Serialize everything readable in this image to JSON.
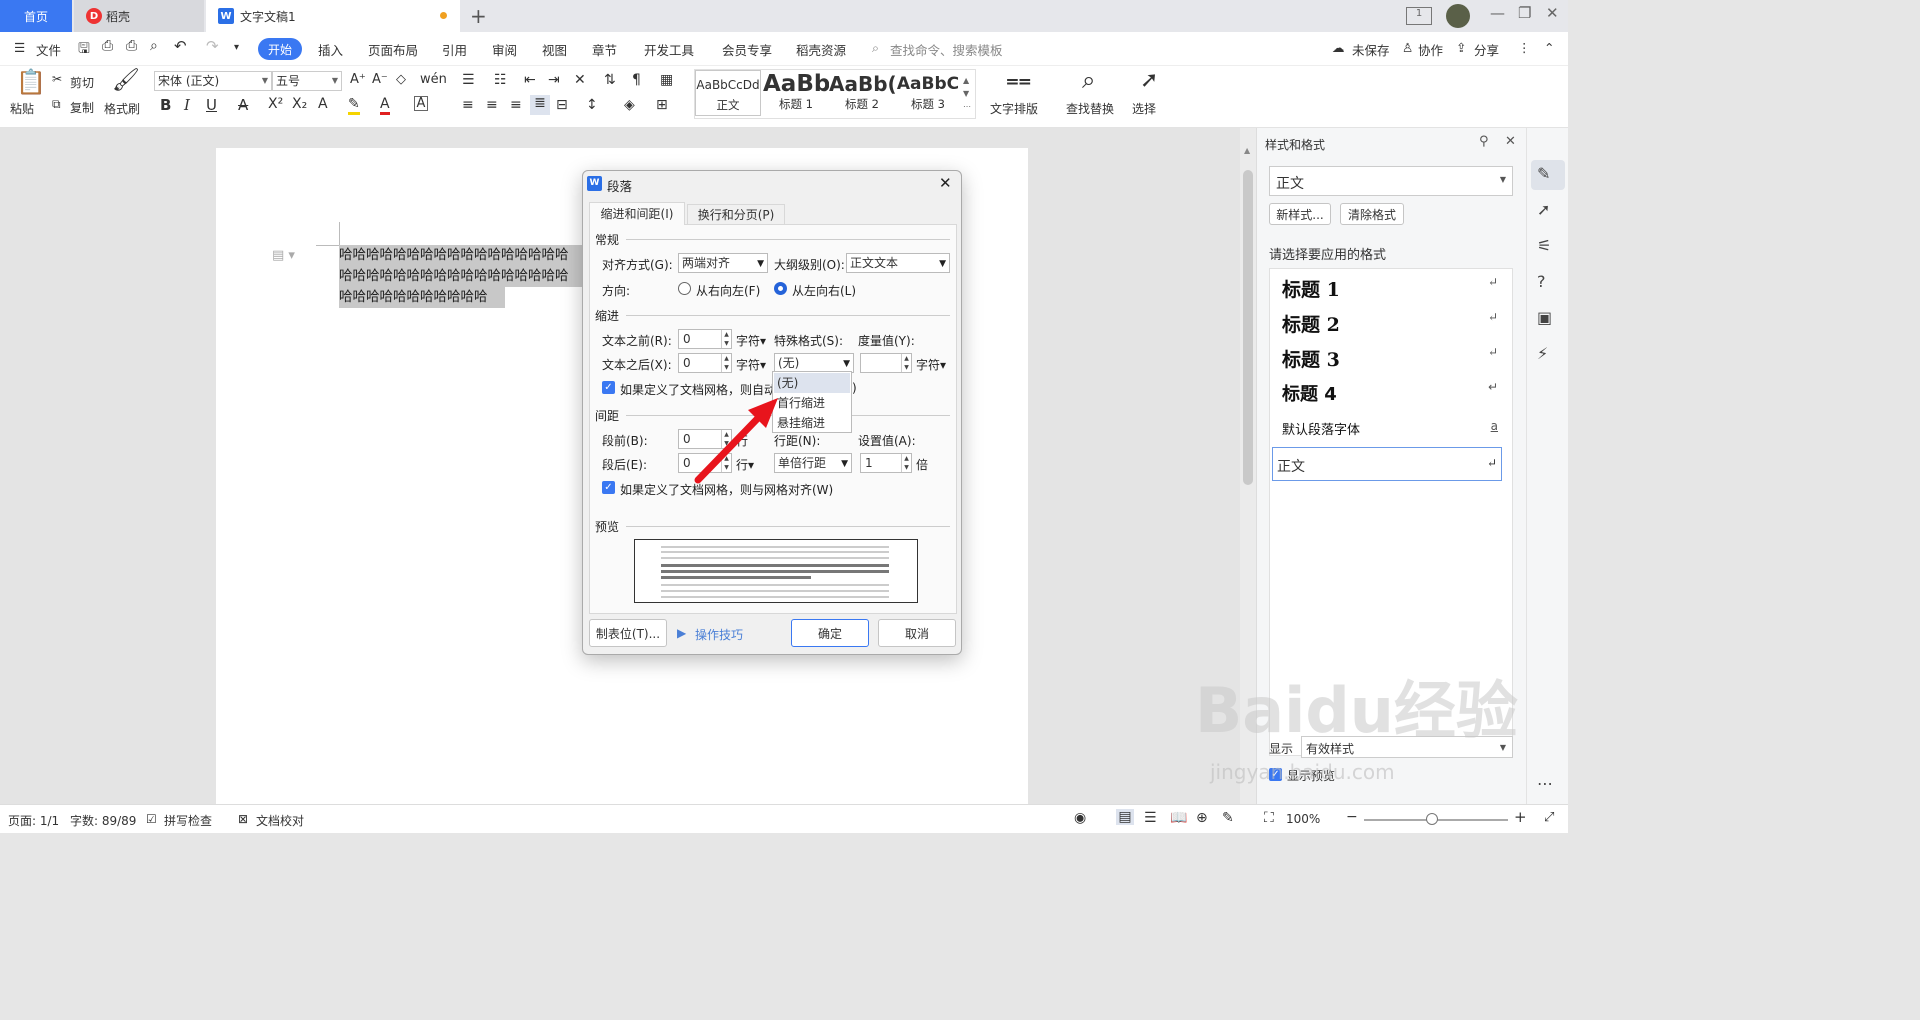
{
  "tabs": {
    "home": "首页",
    "daoke": "稻壳",
    "doc": "文字文稿1",
    "add": "+"
  },
  "window": {
    "minimize": "—",
    "restore": "❐",
    "close": "✕"
  },
  "menu": {
    "file": "文件",
    "items": [
      "开始",
      "插入",
      "页面布局",
      "引用",
      "审阅",
      "视图",
      "章节",
      "开发工具",
      "会员专享",
      "稻壳资源"
    ],
    "search_placeholder": "查找命令、搜索模板",
    "unsaved": "未保存",
    "collab": "协作",
    "share": "分享"
  },
  "ribbon": {
    "paste": "粘贴",
    "cut": "剪切",
    "copy": "复制",
    "format_painter": "格式刷",
    "font": "宋体 (正文)",
    "size": "五号",
    "styles": [
      {
        "sample": "AaBbCcDd",
        "name": "正文"
      },
      {
        "sample": "AaBb",
        "name": "标题 1"
      },
      {
        "sample": "AaBb(",
        "name": "标题 2"
      },
      {
        "sample": "AaBbC",
        "name": "标题 3"
      }
    ],
    "text_layout": "文字排版",
    "find_replace": "查找替换",
    "select": "选择"
  },
  "document": {
    "lines": [
      "哈哈哈哈哈哈哈哈哈哈哈哈哈哈哈哈哈",
      "哈哈哈哈哈哈哈哈哈哈哈哈哈哈哈哈哈",
      "哈哈哈哈哈哈哈哈哈哈哈"
    ]
  },
  "dialog": {
    "title": "段落",
    "tabs": [
      "缩进和间距(I)",
      "换行和分页(P)"
    ],
    "general": "常规",
    "align_label": "对齐方式(G):",
    "align_value": "两端对齐",
    "outline_label": "大纲级别(O):",
    "outline_value": "正文文本",
    "direction_label": "方向:",
    "rtl": "从右向左(F)",
    "ltr": "从左向右(L)",
    "indent": "缩进",
    "before_text": "文本之前(R):",
    "before_val": "0",
    "after_text": "文本之后(X):",
    "after_val": "0",
    "unit_char": "字符",
    "special_label": "特殊格式(S):",
    "special_value": "(无)",
    "measure_label": "度量值(Y):",
    "measure_unit": "字符",
    "grid_check": "如果定义了文档网格，则自动",
    "grid_check_tail": ")",
    "spacing": "间距",
    "space_before": "段前(B):",
    "space_before_val": "0",
    "space_after": "段后(E):",
    "space_after_val": "0",
    "unit_line": "行",
    "line_spacing_label": "行距(N):",
    "line_spacing_value": "单倍行距",
    "set_value_label": "设置值(A):",
    "set_value": "1",
    "set_unit": "倍",
    "grid_check2": "如果定义了文档网格，则与网格对齐(W)",
    "preview": "预览",
    "tabs_btn": "制表位(T)...",
    "tips": "操作技巧",
    "ok": "确定",
    "cancel": "取消",
    "dropdown": [
      "(无)",
      "首行缩进",
      "悬挂缩进"
    ]
  },
  "panel": {
    "title": "样式和格式",
    "current": "正文",
    "new_style": "新样式...",
    "clear": "清除格式",
    "choose": "请选择要应用的格式",
    "styles": [
      "标题  1",
      "标题  2",
      "标题  3",
      "标题  4"
    ],
    "default_font": "默认段落字体",
    "body": "正文",
    "show": "显示",
    "show_value": "有效样式",
    "show_preview": "显示预览"
  },
  "status": {
    "page": "页面: 1/1",
    "words": "字数: 89/89",
    "spell": "拼写检查",
    "proof": "文档校对",
    "zoom": "100%"
  },
  "watermark": {
    "main": "Baidu经验",
    "sub": "jingyan.baidu.com"
  }
}
